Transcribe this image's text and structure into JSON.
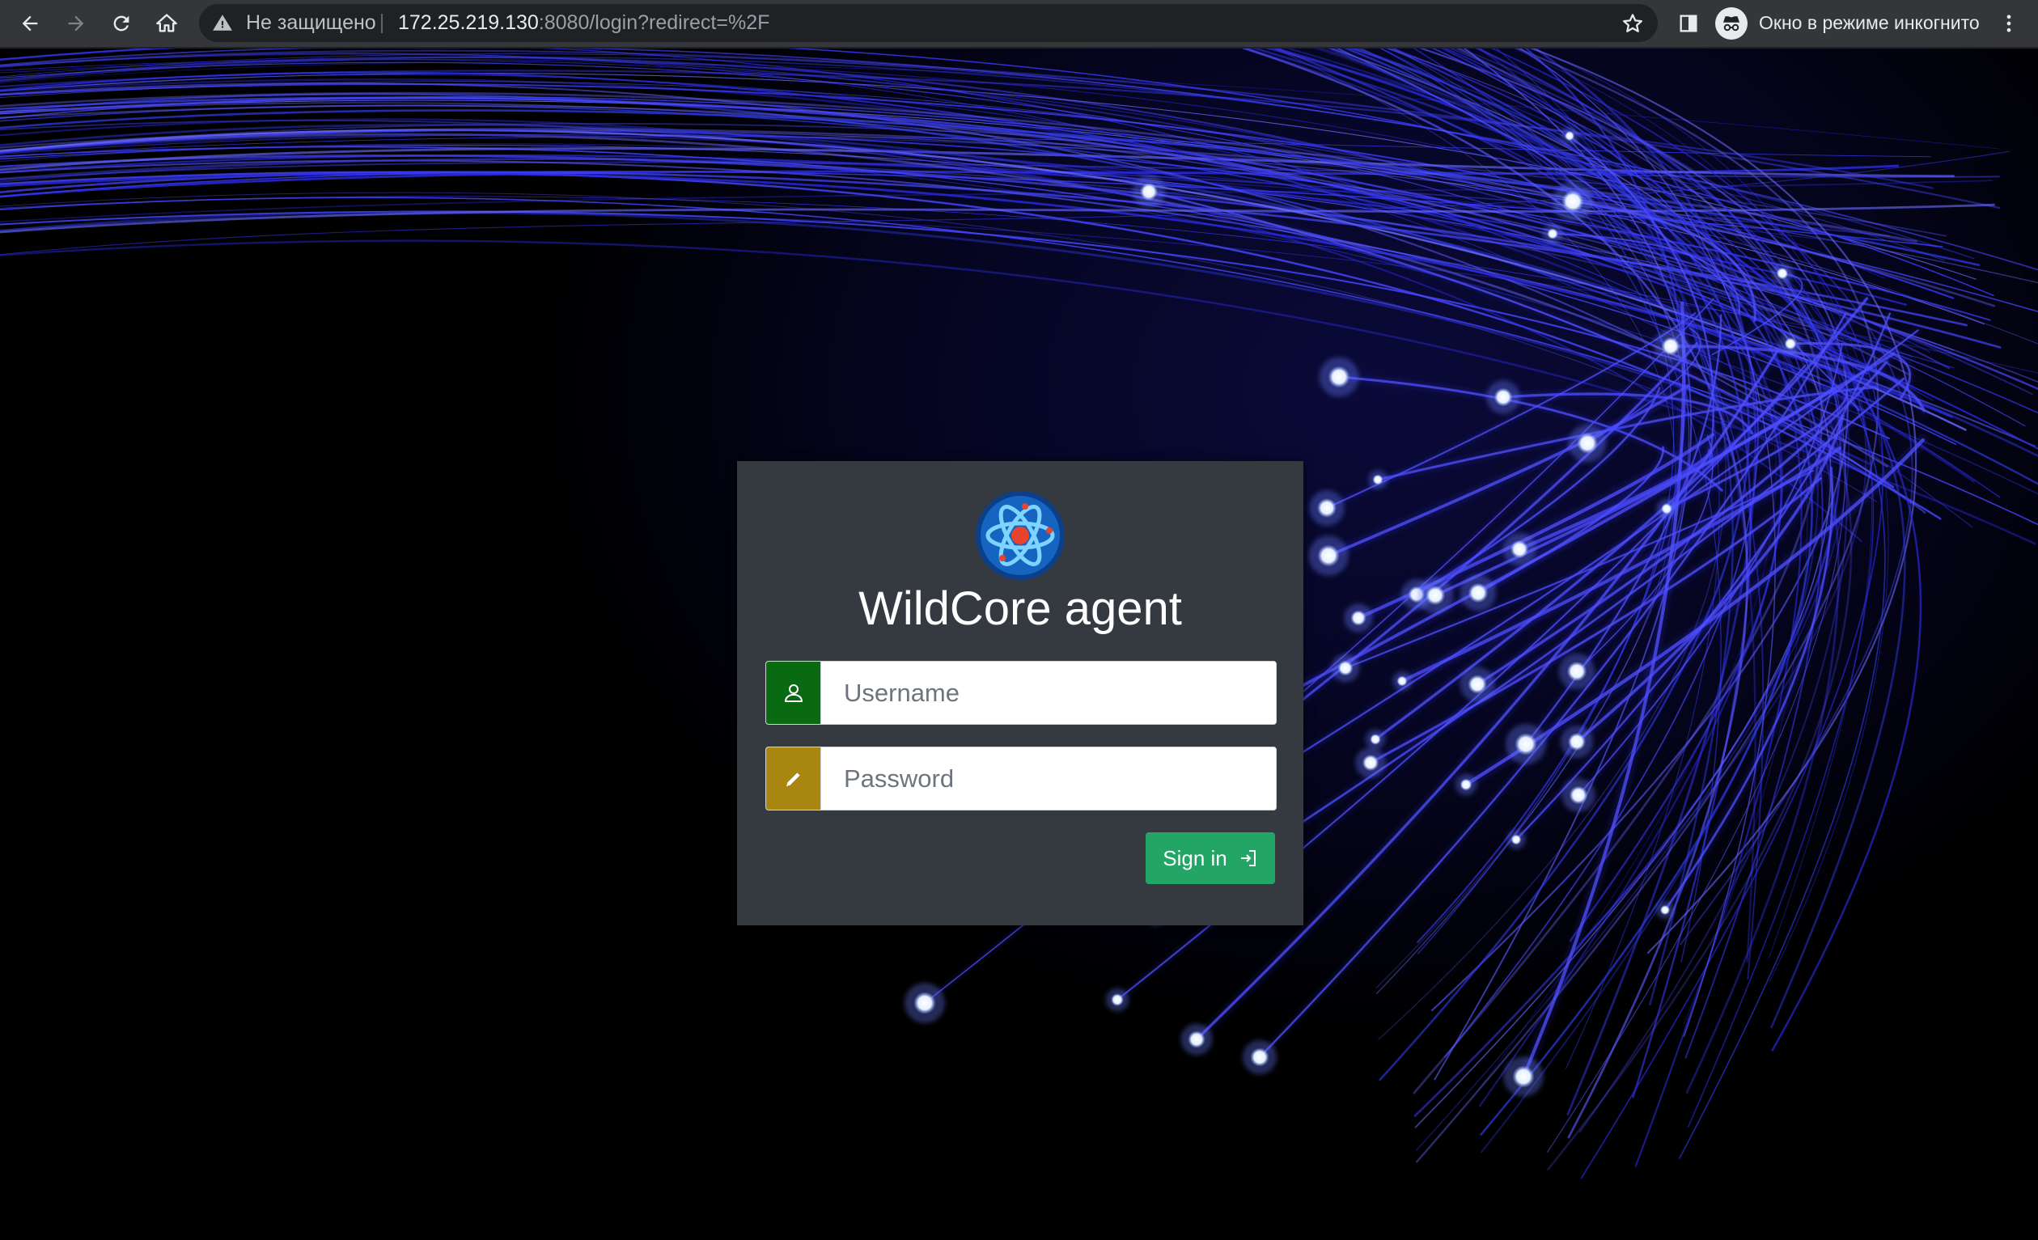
{
  "browser": {
    "security_label": "Не защищено",
    "url_host": "172.25.219.130",
    "url_rest": ":8080/login?redirect=%2F",
    "incognito_label": "Окно в режиме инкогнито",
    "icons": {
      "back": "back-arrow-icon",
      "forward": "forward-arrow-icon",
      "reload": "reload-icon",
      "home": "home-icon",
      "warning": "warning-triangle-icon",
      "bookmark": "star-icon",
      "side_panel": "side-panel-icon",
      "incognito": "incognito-icon",
      "menu": "kebab-menu-icon"
    }
  },
  "login": {
    "title": "WildCore agent",
    "username_placeholder": "Username",
    "password_placeholder": "Password",
    "signin_label": "Sign in",
    "colors": {
      "card": "#343a40",
      "username_addon": "#0a6a12",
      "password_addon": "#a88610",
      "signin_button": "#22a565"
    },
    "icons": {
      "logo": "atom-logo-icon",
      "user": "user-icon",
      "password": "pencil-icon",
      "signin": "sign-in-icon"
    }
  }
}
